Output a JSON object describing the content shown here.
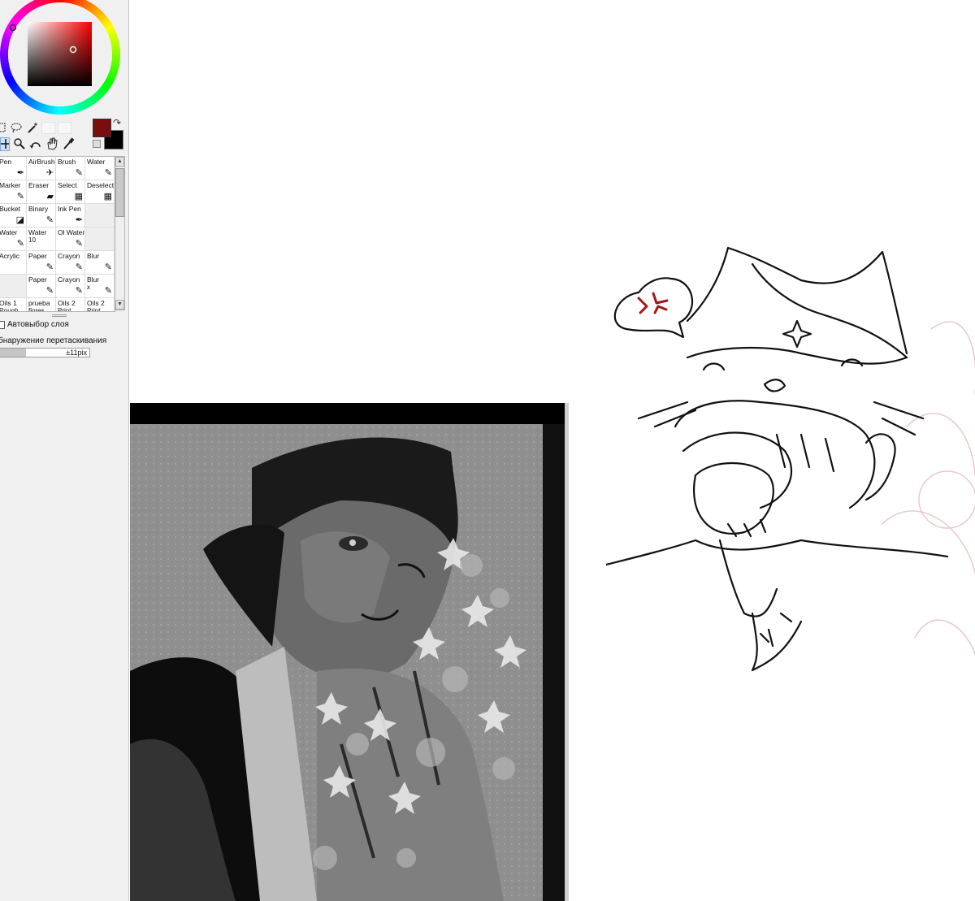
{
  "colors": {
    "foreground": "#7a0d0d",
    "background": "#000000",
    "panel": "#f0f0f0",
    "angry_mark": "#a01818"
  },
  "icons": {
    "selection_row": [
      "rect-select-icon",
      "lasso-select-icon",
      "magic-wand-icon"
    ],
    "navigation_row": [
      "move-icon",
      "zoom-icon",
      "rotate-icon",
      "hand-icon",
      "eyedropper-icon"
    ]
  },
  "brushes": [
    [
      {
        "label": "Pen",
        "icon": "pen-icon"
      },
      {
        "label": "AirBrush",
        "icon": "airbrush-icon"
      },
      {
        "label": "Brush",
        "icon": "brush-icon"
      },
      {
        "label": "Water",
        "icon": "water-icon"
      }
    ],
    [
      {
        "label": "Marker",
        "icon": "marker-icon"
      },
      {
        "label": "Eraser",
        "icon": "eraser-icon"
      },
      {
        "label": "Select",
        "icon": "select-icon"
      },
      {
        "label": "Deselect",
        "icon": "deselect-icon"
      }
    ],
    [
      {
        "label": "Bucket",
        "icon": "bucket-icon"
      },
      {
        "label": "Binary",
        "icon": "binary-icon"
      },
      {
        "label": "Ink Pen",
        "icon": "ink-pen-icon"
      },
      {
        "label": "",
        "icon": ""
      }
    ],
    [
      {
        "label": "Water",
        "icon": "water-icon"
      },
      {
        "label": "Water",
        "sub": "10",
        "icon": ""
      },
      {
        "label": "Ol Water",
        "icon": "oil-water-icon"
      },
      {
        "label": "",
        "icon": ""
      }
    ],
    [
      {
        "label": "Acrylic",
        "icon": ""
      },
      {
        "label": "Paper",
        "icon": "paper-icon"
      },
      {
        "label": "Crayon",
        "icon": "crayon-icon"
      },
      {
        "label": "Blur",
        "icon": "blur-icon"
      }
    ],
    [
      {
        "label": "",
        "icon": ""
      },
      {
        "label": "Paper",
        "icon": "paper-icon"
      },
      {
        "label": "Crayon",
        "icon": "crayon-icon"
      },
      {
        "label": "Blur",
        "sub": "x",
        "icon": "blur-icon"
      }
    ],
    [
      {
        "label": "Oils 1",
        "sub": "Rough",
        "icon": ""
      },
      {
        "label": "prueba",
        "sub": "flores",
        "icon": ""
      },
      {
        "label": "Oils 2",
        "sub": "Print",
        "icon": ""
      },
      {
        "label": "Oils 2",
        "sub": "Print",
        "icon": ""
      }
    ]
  ],
  "options": {
    "auto_select_layer": "Автовыбор слоя",
    "drag_detection": "бнаружение перетаскивания",
    "drag_value": "±11pix",
    "drag_fraction": 0.3
  },
  "canvas": {
    "speech_mark": "anger-symbol"
  }
}
